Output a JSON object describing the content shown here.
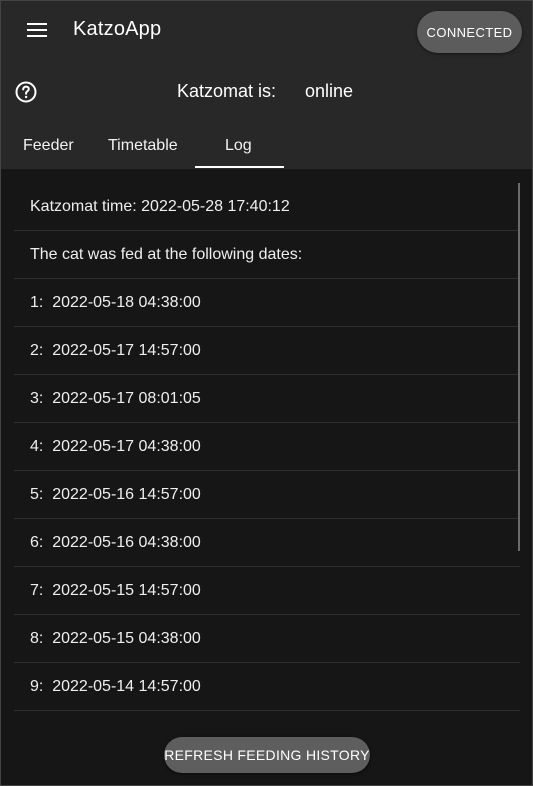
{
  "app": {
    "title": "KatzoApp",
    "connection_button": "CONNECTED",
    "menu_icon": "hamburger-menu-icon",
    "help_icon": "question-circle-icon"
  },
  "status": {
    "label": "Katzomat is:",
    "value": "online"
  },
  "tabs": [
    {
      "label": "Feeder",
      "active": false
    },
    {
      "label": "Timetable",
      "active": false
    },
    {
      "label": "Log",
      "active": true
    }
  ],
  "log": {
    "time_line": "Katzomat time: 2022-05-28 17:40:12",
    "intro": "The cat was fed at the following dates:",
    "entries": [
      "1:  2022-05-18 04:38:00",
      "2:  2022-05-17 14:57:00",
      "3:  2022-05-17 08:01:05",
      "4:  2022-05-17 04:38:00",
      "5:  2022-05-16 14:57:00",
      "6:  2022-05-16 04:38:00",
      "7:  2022-05-15 14:57:00",
      "8:  2022-05-15 04:38:00",
      "9:  2022-05-14 14:57:00"
    ]
  },
  "refresh_button": "REFRESH FEEDING HISTORY",
  "colors": {
    "background": "#161616",
    "appbar": "#282828",
    "button": "#5c5c5c",
    "text": "#ffffff"
  }
}
